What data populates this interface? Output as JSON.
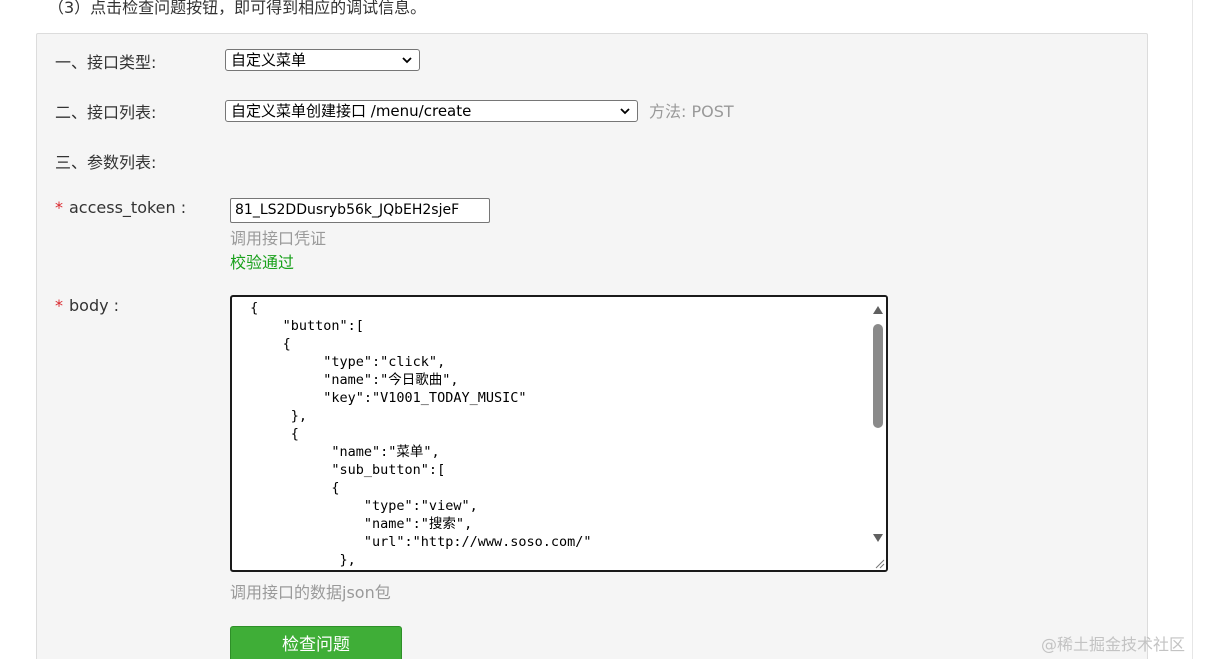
{
  "intro_note": "（3）点击检查问题按钮，即可得到相应的调试信息。",
  "form": {
    "interface_type": {
      "label": "一、接口类型:",
      "value": "自定义菜单"
    },
    "interface_list": {
      "label": "二、接口列表:",
      "value": "自定义菜单创建接口 /menu/create",
      "method": "方法:  POST"
    },
    "param_list": {
      "label": "三、参数列表:"
    },
    "access_token": {
      "required_mark": "*",
      "label": "access_token :",
      "value": "81_LS2DDusryb56k_JQbEH2sjeF",
      "hint": "调用接口凭证",
      "status": "校验通过"
    },
    "body": {
      "required_mark": "*",
      "label": "body :",
      "value": " {\n     \"button\":[\n     {\n          \"type\":\"click\",\n          \"name\":\"今日歌曲\",\n          \"key\":\"V1001_TODAY_MUSIC\"\n      },\n      {\n           \"name\":\"菜单\",\n           \"sub_button\":[\n           {\n               \"type\":\"view\",\n               \"name\":\"搜索\",\n               \"url\":\"http://www.soso.com/\"\n            },",
      "hint": "调用接口的数据json包"
    },
    "submit_label": "检查问题"
  },
  "watermark": "@稀土掘金技术社区"
}
